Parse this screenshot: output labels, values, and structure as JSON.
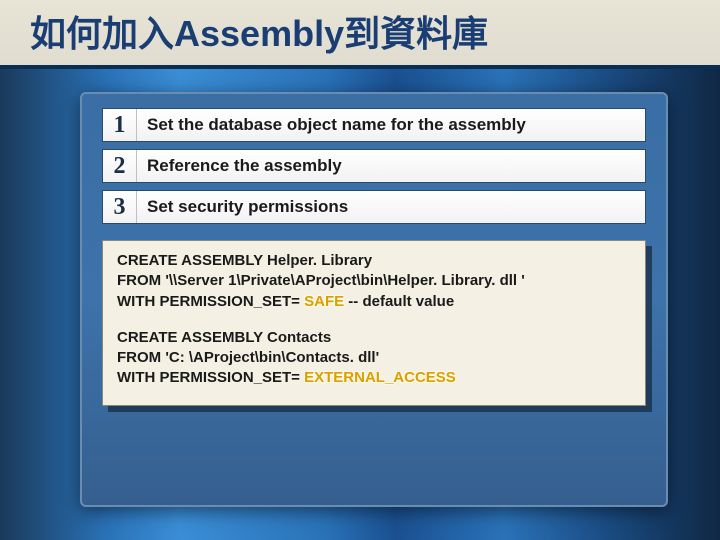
{
  "title": "如何加入Assembly到資料庫",
  "steps": [
    {
      "n": "1",
      "text": "Set the database object name for the assembly"
    },
    {
      "n": "2",
      "text": "Reference the assembly"
    },
    {
      "n": "3",
      "text": "Set security permissions"
    }
  ],
  "code": {
    "block1": {
      "l1": "CREATE ASSEMBLY Helper. Library",
      "l2": "FROM '\\\\Server 1\\Private\\AProject\\bin\\Helper. Library. dll '",
      "l3a": "WITH PERMISSION_SET= ",
      "l3b_keyword": "SAFE",
      "l3c": " -- default value"
    },
    "block2": {
      "l1": "CREATE ASSEMBLY Contacts",
      "l2": "FROM 'C: \\AProject\\bin\\Contacts. dll'",
      "l3a": "WITH PERMISSION_SET= ",
      "l3b_keyword": "EXTERNAL_ACCESS"
    }
  }
}
